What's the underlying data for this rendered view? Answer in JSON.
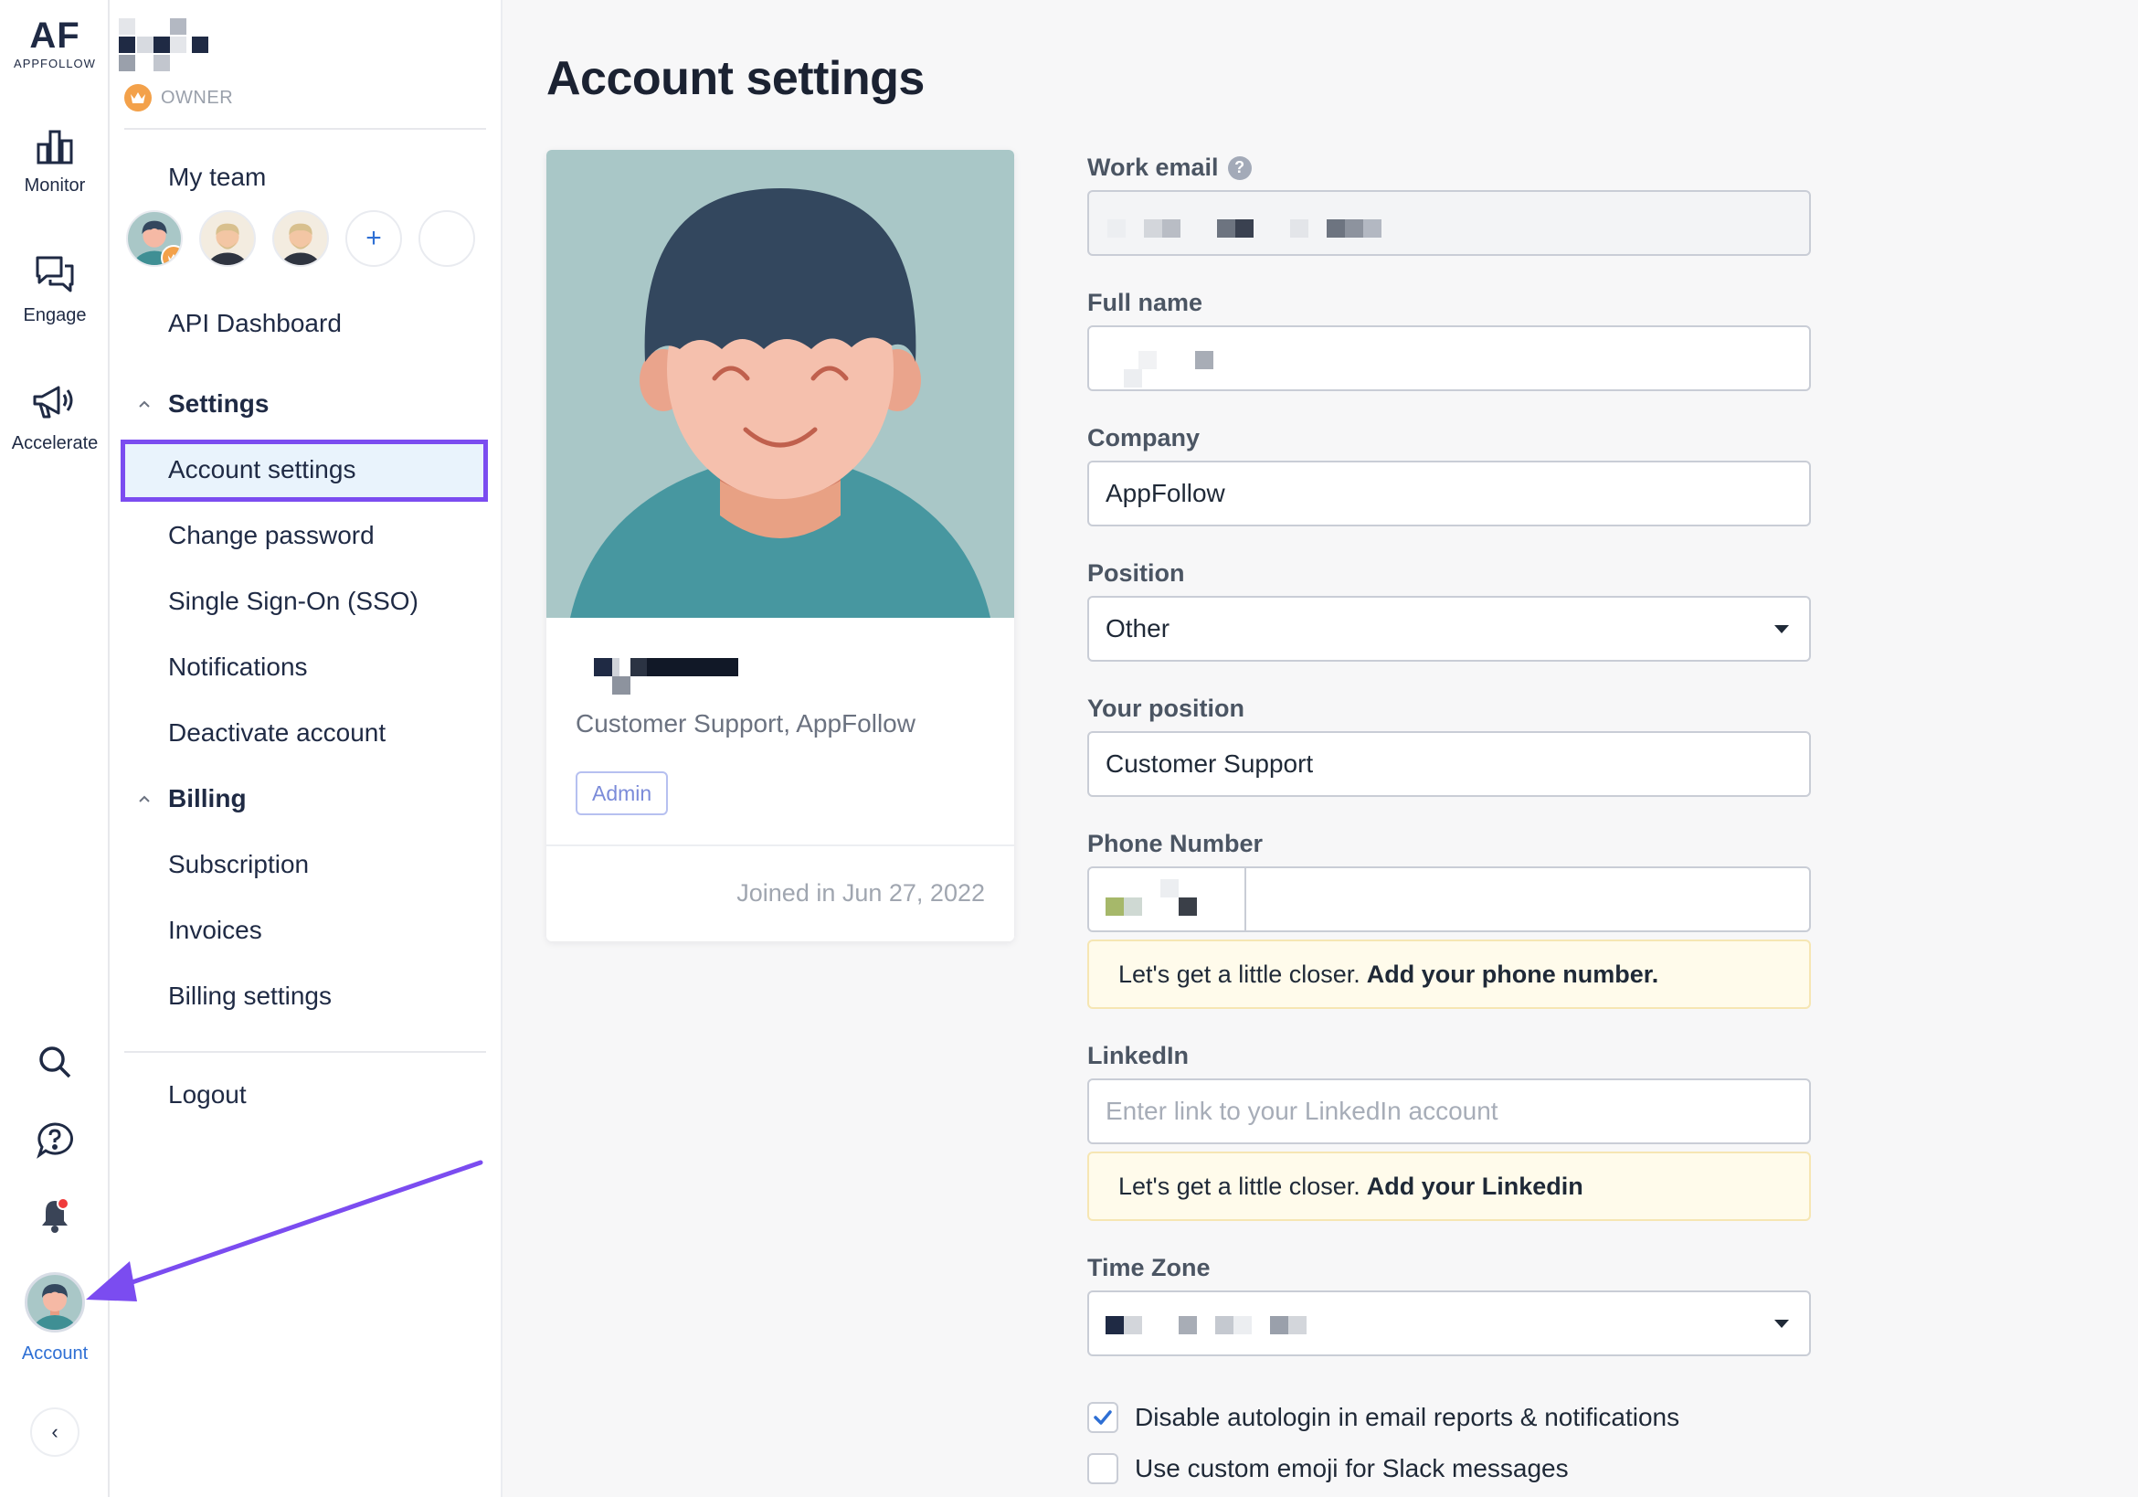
{
  "brand": {
    "mark": "AF",
    "wordmark": "APPFOLLOW"
  },
  "rail": {
    "items": [
      {
        "label": "Monitor",
        "icon": "bar-chart-icon"
      },
      {
        "label": "Engage",
        "icon": "chat-bubbles-icon"
      },
      {
        "label": "Accelerate",
        "icon": "megaphone-icon"
      }
    ],
    "bottom_icons": [
      "search-icon",
      "help-circle-icon",
      "bell-icon"
    ],
    "account_label": "Account",
    "collapse_glyph": "‹"
  },
  "sidebar": {
    "workspace_role": "OWNER",
    "my_team": "My team",
    "add_member_glyph": "+",
    "api_dashboard": "API Dashboard",
    "settings_header": "Settings",
    "settings_items": [
      "Account settings",
      "Change password",
      "Single Sign-On (SSO)",
      "Notifications",
      "Deactivate account"
    ],
    "active_item": "Account settings",
    "billing_header": "Billing",
    "billing_items": [
      "Subscription",
      "Invoices",
      "Billing settings"
    ],
    "logout": "Logout"
  },
  "page": {
    "title": "Account settings"
  },
  "profile_card": {
    "role_line": "Customer Support, AppFollow",
    "badge": "Admin",
    "joined": "Joined in Jun 27, 2022"
  },
  "form": {
    "work_email": {
      "label": "Work email",
      "help_glyph": "?"
    },
    "full_name": {
      "label": "Full name"
    },
    "company": {
      "label": "Company",
      "value": "AppFollow"
    },
    "position": {
      "label": "Position",
      "value": "Other"
    },
    "your_position": {
      "label": "Your position",
      "value": "Customer Support"
    },
    "phone": {
      "label": "Phone Number"
    },
    "phone_notice": {
      "text": "Let's get a little closer.",
      "link": "Add your phone number."
    },
    "linkedin": {
      "label": "LinkedIn",
      "placeholder": "Enter link to your LinkedIn account"
    },
    "linkedin_notice": {
      "text": "Let's get a little closer.",
      "link": "Add your Linkedin"
    },
    "time_zone": {
      "label": "Time Zone"
    },
    "checkboxes": [
      {
        "label": "Disable autologin in email reports & notifications",
        "checked": true
      },
      {
        "label": "Use custom emoji for Slack messages",
        "checked": false
      }
    ]
  },
  "colors": {
    "accent_purple": "#7b4cf0",
    "link_blue": "#2e6fd4",
    "active_bg": "#e9f3fc",
    "owner_orange": "#f3a14a",
    "notice_bg": "#fffbeb"
  }
}
